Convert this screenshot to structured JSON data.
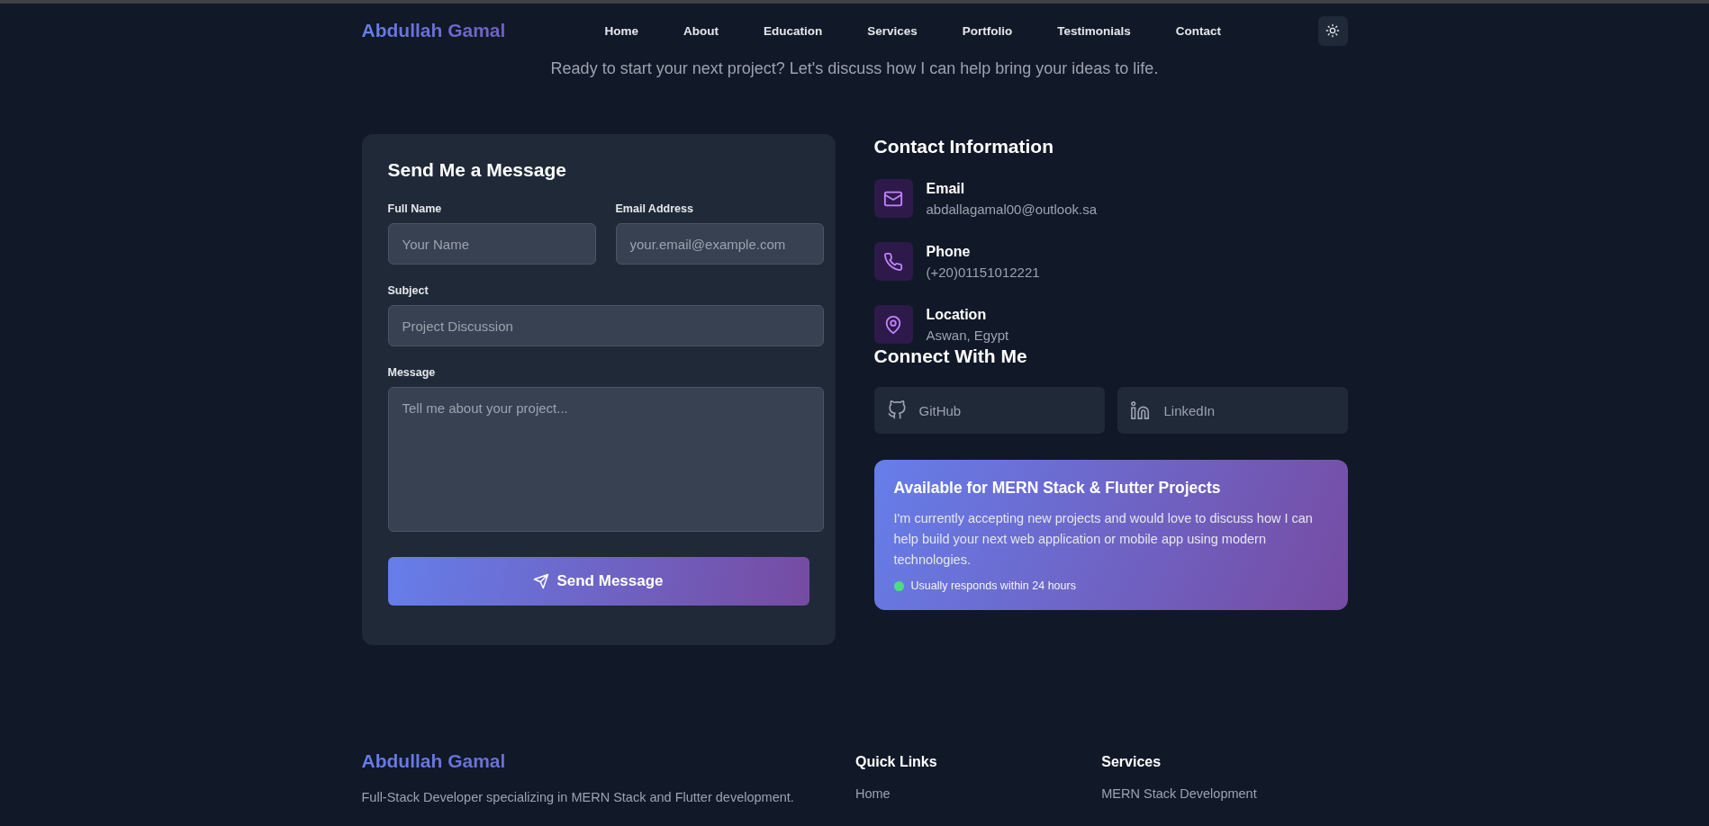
{
  "nav": {
    "brand": "Abdullah Gamal",
    "links": [
      "Home",
      "About",
      "Education",
      "Services",
      "Portfolio",
      "Testimonials",
      "Contact"
    ]
  },
  "intro": "Ready to start your next project? Let's discuss how I can help bring your ideas to life.",
  "form": {
    "title": "Send Me a Message",
    "fields": [
      {
        "label": "Full Name",
        "placeholder": "Your Name",
        "kind": "input"
      },
      {
        "label": "Email Address",
        "placeholder": "your.email@example.com",
        "kind": "input"
      },
      {
        "label": "Subject",
        "placeholder": "Project Discussion",
        "kind": "wide"
      },
      {
        "label": "Message",
        "placeholder": "Tell me about your project...",
        "kind": "textarea"
      }
    ],
    "submit": "Send Message"
  },
  "contact": {
    "title": "Contact Information",
    "items": [
      {
        "kind": "email",
        "label": "Email",
        "value": "abdallagamal00@outlook.sa"
      },
      {
        "kind": "phone",
        "label": "Phone",
        "value": "(+20)01151012221"
      },
      {
        "kind": "location",
        "label": "Location",
        "value": "Aswan, Egypt"
      }
    ]
  },
  "social": {
    "title": "Connect With Me",
    "links": [
      {
        "kind": "github",
        "label": "GitHub"
      },
      {
        "kind": "linkedin",
        "label": "LinkedIn"
      }
    ]
  },
  "availability": {
    "title": "Available for MERN Stack & Flutter Projects",
    "text": "I'm currently accepting new projects and would love to discuss how I can help build your next web application or mobile app using modern technologies.",
    "status": "Usually responds within 24 hours",
    "color": "#4ade80"
  },
  "footer": {
    "brand": "Abdullah Gamal",
    "description": "Full-Stack Developer specializing in MERN Stack and Flutter development.",
    "columns": [
      {
        "title": "Quick Links",
        "items": [
          "Home"
        ]
      },
      {
        "title": "Services",
        "items": [
          "MERN Stack Development"
        ]
      }
    ]
  }
}
